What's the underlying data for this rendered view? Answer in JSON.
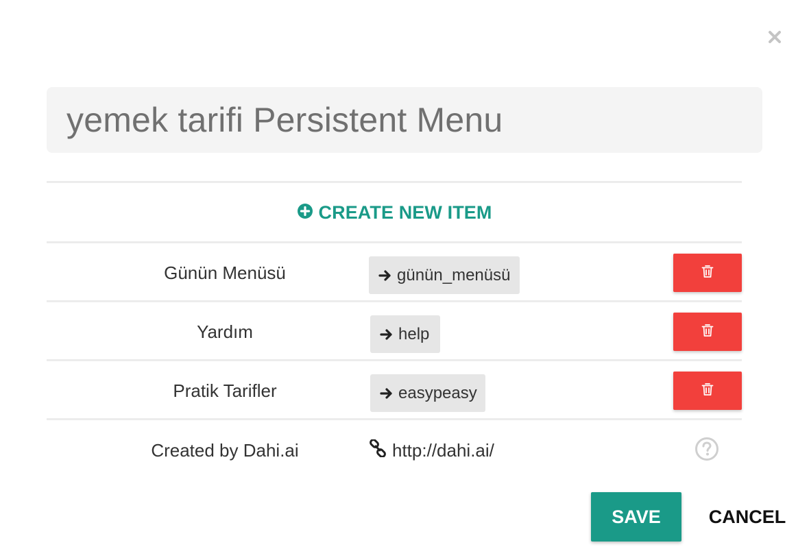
{
  "dialog": {
    "close_icon": "close-icon",
    "title": "yemek tarifi Persistent Menu"
  },
  "create": {
    "icon": "plus-circle-icon",
    "label": "CREATE NEW ITEM",
    "color": "#1a9a88"
  },
  "items": [
    {
      "label": "Günün Menüsü",
      "payload": "günün_menüsü",
      "payload_icon": "arrow-right-icon",
      "delete_icon": "trash-icon"
    },
    {
      "label": "Yardım",
      "payload": "help",
      "payload_icon": "arrow-right-icon",
      "delete_icon": "trash-icon"
    },
    {
      "label": "Pratik Tarifler",
      "payload": "easypeasy",
      "payload_icon": "arrow-right-icon",
      "delete_icon": "trash-icon"
    }
  ],
  "footer": {
    "label": "Created by Dahi.ai",
    "link_icon": "link-icon",
    "link": "http://dahi.ai/",
    "help_icon": "question-circle-icon"
  },
  "actions": {
    "save_label": "SAVE",
    "cancel_label": "CANCEL",
    "save_color": "#1a9a88",
    "delete_color": "#f2403c"
  }
}
